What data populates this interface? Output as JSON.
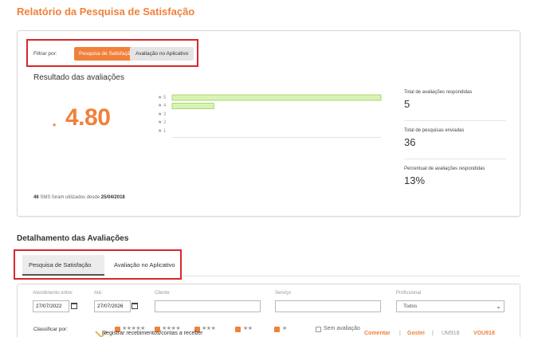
{
  "page_title": "Relatório da Pesquisa de Satisfação",
  "filter": {
    "label": "Filtrar por:",
    "options": [
      "Pesquisa de Satisfação",
      "Avaliação no Aplicativo"
    ],
    "active": "Pesquisa de Satisfação"
  },
  "results": {
    "title": "Resultado das avaliações",
    "average": "4.80",
    "star_glyph": "★"
  },
  "chart_data": {
    "type": "bar",
    "orientation": "horizontal",
    "categories": [
      "★ 5",
      "★ 4",
      "★ 3",
      "★ 2",
      "★ 1"
    ],
    "values": [
      30,
      6,
      0,
      0,
      0
    ],
    "xlim": [
      0,
      30
    ],
    "grid": false,
    "bar_color": "#d9f3b4",
    "bar_border": "#9bd05a"
  },
  "stats": [
    {
      "label": "Total de avaliações respondidas",
      "value": "5"
    },
    {
      "label": "Total de pesquisas enviadas",
      "value": "36"
    },
    {
      "label": "Percentual de avaliações respondidas",
      "value": "13%"
    }
  ],
  "sms_note": {
    "count": "46",
    "text": "SMS foram utilizados desde",
    "date": "25/04/2018"
  },
  "details": {
    "title": "Detalhamento das Avaliações",
    "tabs": [
      "Pesquisa de Satisfação",
      "Avaliação no Aplicativo"
    ],
    "active_tab": "Pesquisa de Satisfação"
  },
  "form": {
    "start_label": "Atendimento entre:",
    "start_value": "27/07/2022",
    "end_label": "Até:",
    "end_value": "27/07/2026",
    "client_label": "Cliente",
    "client_value": "",
    "service_label": "Serviço",
    "service_value": "",
    "professional_label": "Profissional",
    "professional_value": "Todos"
  },
  "sort": {
    "label": "Classificar por:",
    "options": [
      "★★★★★",
      "★★★★",
      "★★★",
      "★★",
      "★"
    ],
    "no_eval_label": "Sem avaliação"
  },
  "overlay": {
    "text": "Registrar recebimentos/contas a receber",
    "comment": "Comentar",
    "separator": "|",
    "like": "Gostei",
    "partial_1": "UM918",
    "partial_2": "VOU918"
  },
  "colors": {
    "accent": "#f0813a",
    "highlight_border": "#d9262c"
  }
}
